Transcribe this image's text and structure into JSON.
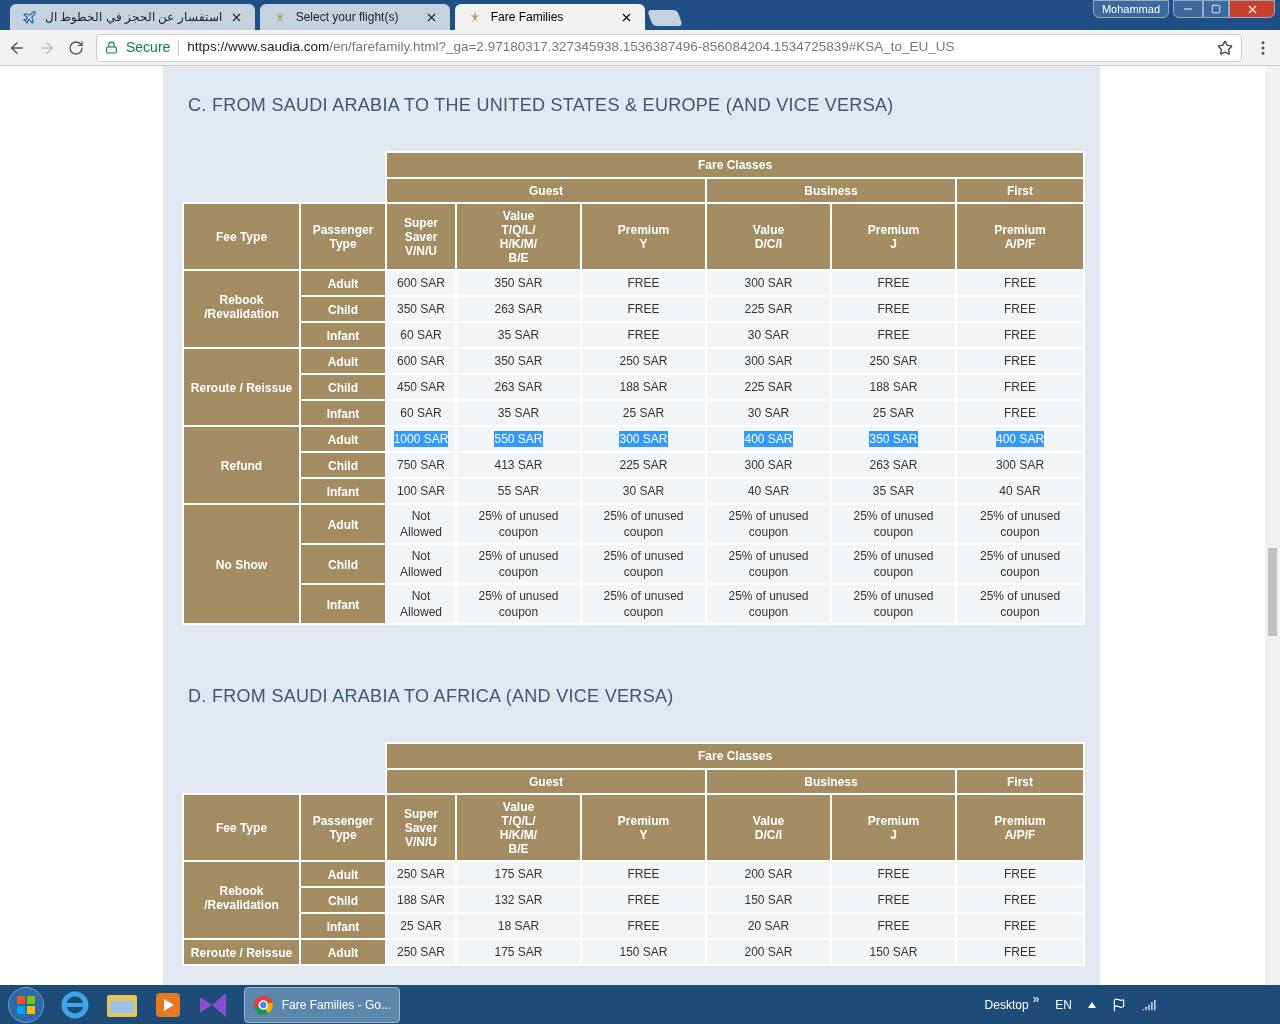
{
  "browser": {
    "tabs": [
      {
        "title": "استفسار عن الحجز في الخطوط ال",
        "selected": false
      },
      {
        "title": "Select your flight(s)",
        "selected": false
      },
      {
        "title": "Fare Families",
        "selected": true
      }
    ],
    "profile": "Mohammad",
    "address": {
      "secure_label": "Secure",
      "origin": "https://www.saudia.com",
      "rest": "/en/farefamily.html?_ga=2.97180317.327345938.1536387496-856084204.1534725839#KSA_to_EU_US"
    }
  },
  "sections": [
    {
      "heading": "C. FROM SAUDI ARABIA TO THE UNITED STATES & EUROPE (AND VICE VERSA)",
      "table": {
        "top_header": "Fare Classes",
        "fee_type_header": "Fee Type",
        "passenger_header": "Passenger\nType",
        "groups": [
          {
            "label": "Guest",
            "columns": [
              "Super\nSaver\nV/N/U",
              "Value\nT/Q/L/\nH/K/M/\nB/E",
              "Premium\nY"
            ]
          },
          {
            "label": "Business",
            "columns": [
              "Value\nD/C/I",
              "Premium\nJ"
            ]
          },
          {
            "label": "First",
            "columns": [
              "Premium\nA/P/F"
            ]
          }
        ],
        "fee_groups": [
          {
            "fee_type": "Rebook\n/Revalidation",
            "rows": [
              {
                "passenger": "Adult",
                "selected": false,
                "cells": [
                  "600 SAR",
                  "350 SAR",
                  "FREE",
                  "300 SAR",
                  "FREE",
                  "FREE"
                ]
              },
              {
                "passenger": "Child",
                "selected": false,
                "cells": [
                  "350 SAR",
                  "263 SAR",
                  "FREE",
                  "225 SAR",
                  "FREE",
                  "FREE"
                ]
              },
              {
                "passenger": "Infant",
                "selected": false,
                "cells": [
                  "60 SAR",
                  "35 SAR",
                  "FREE",
                  "30 SAR",
                  "FREE",
                  "FREE"
                ]
              }
            ]
          },
          {
            "fee_type": "Reroute / Reissue",
            "rows": [
              {
                "passenger": "Adult",
                "selected": false,
                "cells": [
                  "600 SAR",
                  "350 SAR",
                  "250 SAR",
                  "300 SAR",
                  "250 SAR",
                  "FREE"
                ]
              },
              {
                "passenger": "Child",
                "selected": false,
                "cells": [
                  "450 SAR",
                  "263 SAR",
                  "188 SAR",
                  "225 SAR",
                  "188 SAR",
                  "FREE"
                ]
              },
              {
                "passenger": "Infant",
                "selected": false,
                "cells": [
                  "60 SAR",
                  "35 SAR",
                  "25 SAR",
                  "30 SAR",
                  "25 SAR",
                  "FREE"
                ]
              }
            ]
          },
          {
            "fee_type": "Refund",
            "rows": [
              {
                "passenger": "Adult",
                "selected": true,
                "cells": [
                  "1000 SAR",
                  "550 SAR",
                  "300 SAR",
                  "400 SAR",
                  "350 SAR",
                  "400 SAR"
                ]
              },
              {
                "passenger": "Child",
                "selected": false,
                "cells": [
                  "750 SAR",
                  "413 SAR",
                  "225 SAR",
                  "300 SAR",
                  "263 SAR",
                  "300 SAR"
                ]
              },
              {
                "passenger": "Infant",
                "selected": false,
                "cells": [
                  "100 SAR",
                  "55 SAR",
                  "30 SAR",
                  "40 SAR",
                  "35 SAR",
                  "40 SAR"
                ]
              }
            ]
          },
          {
            "fee_type": "No Show",
            "rows": [
              {
                "passenger": "Adult",
                "selected": false,
                "cells": [
                  "Not Allowed",
                  "25% of unused coupon",
                  "25% of unused coupon",
                  "25% of unused coupon",
                  "25% of unused coupon",
                  "25% of unused coupon"
                ]
              },
              {
                "passenger": "Child",
                "selected": false,
                "cells": [
                  "Not Allowed",
                  "25% of unused coupon",
                  "25% of unused coupon",
                  "25% of unused coupon",
                  "25% of unused coupon",
                  "25% of unused coupon"
                ]
              },
              {
                "passenger": "Infant",
                "selected": false,
                "cells": [
                  "Not Allowed",
                  "25% of unused coupon",
                  "25% of unused coupon",
                  "25% of unused coupon",
                  "25% of unused coupon",
                  "25% of unused coupon"
                ]
              }
            ]
          }
        ]
      }
    },
    {
      "heading": "D. FROM SAUDI ARABIA TO AFRICA (AND VICE VERSA)",
      "table": {
        "top_header": "Fare Classes",
        "fee_type_header": "Fee Type",
        "passenger_header": "Passenger\nType",
        "groups": [
          {
            "label": "Guest",
            "columns": [
              "Super\nSaver\nV/N/U",
              "Value\nT/Q/L/\nH/K/M/\nB/E",
              "Premium\nY"
            ]
          },
          {
            "label": "Business",
            "columns": [
              "Value\nD/C/I",
              "Premium\nJ"
            ]
          },
          {
            "label": "First",
            "columns": [
              "Premium\nA/P/F"
            ]
          }
        ],
        "fee_groups": [
          {
            "fee_type": "Rebook\n/Revalidation",
            "rows": [
              {
                "passenger": "Adult",
                "selected": false,
                "cells": [
                  "250 SAR",
                  "175 SAR",
                  "FREE",
                  "200 SAR",
                  "FREE",
                  "FREE"
                ]
              },
              {
                "passenger": "Child",
                "selected": false,
                "cells": [
                  "188 SAR",
                  "132 SAR",
                  "FREE",
                  "150 SAR",
                  "FREE",
                  "FREE"
                ]
              },
              {
                "passenger": "Infant",
                "selected": false,
                "cells": [
                  "25 SAR",
                  "18 SAR",
                  "FREE",
                  "20 SAR",
                  "FREE",
                  "FREE"
                ]
              }
            ]
          },
          {
            "fee_type": "Reroute / Reissue",
            "rows": [
              {
                "passenger": "Adult",
                "selected": false,
                "cells": [
                  "250 SAR",
                  "175 SAR",
                  "150 SAR",
                  "200 SAR",
                  "150 SAR",
                  "FREE"
                ]
              }
            ]
          }
        ]
      }
    }
  ],
  "taskbar": {
    "task": "Fare Families - Go...",
    "desktop_label": "Desktop",
    "chevron": "»",
    "language": "EN"
  }
}
